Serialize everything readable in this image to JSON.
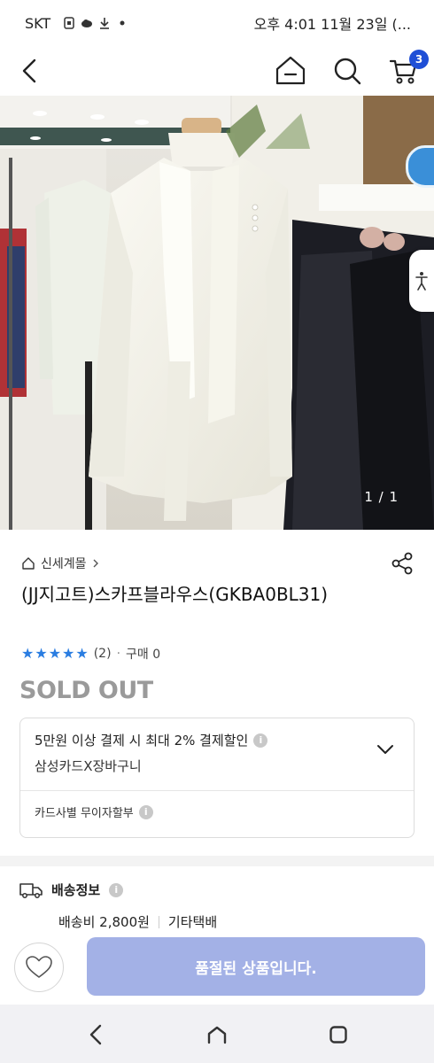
{
  "status_bar": {
    "carrier": "SKT",
    "time_date": "오후 4:01  11월 23일 (...",
    "icons": [
      "screenshot-icon",
      "cloud-icon",
      "download-icon",
      "dot-icon"
    ]
  },
  "top_nav": {
    "cart_count": "3",
    "icons": [
      "back-arrow-icon",
      "home-icon",
      "search-icon",
      "cart-icon"
    ]
  },
  "gallery": {
    "counter": "1 / 1"
  },
  "product": {
    "breadcrumb": "신세계몰",
    "title": "(JJ지고트)스카프블라우스(GKBA0BL31)",
    "rating_count": "(2)",
    "purchase": "구매 0",
    "rating": 5,
    "rating_max": 5,
    "status": "SOLD OUT"
  },
  "benefit": {
    "line1": "5만원 이상 결제 시 최대 2% 결제할인",
    "line2": "삼성카드X장바구니",
    "installment": "카드사별 무이자할부",
    "info_glyph": "i"
  },
  "delivery": {
    "heading": "배송정보",
    "fee": "배송비 2,800원",
    "courier": "기타택배"
  },
  "action_bar": {
    "soldout_label": "품절된 상품입니다."
  },
  "colors": {
    "accent": "#1f4fd6",
    "star": "#2a7de1",
    "soldout_button": "#a3b1e6",
    "soldout_text": "#9a9a9a"
  }
}
